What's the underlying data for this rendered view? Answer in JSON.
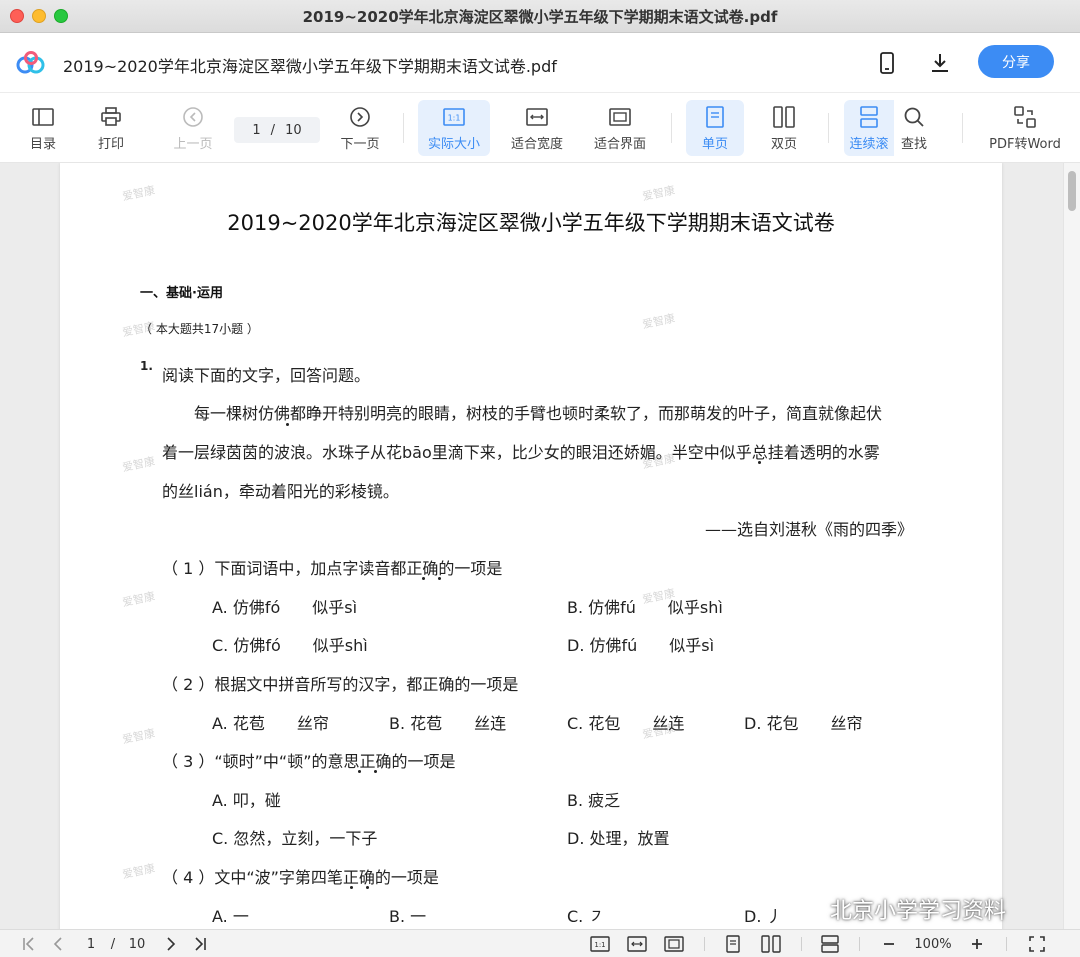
{
  "window": {
    "title": "2019~2020学年北京海淀区翠微小学五年级下学期期末语文试卷.pdf"
  },
  "header": {
    "doc_title": "2019~2020学年北京海淀区翠微小学五年级下学期期末语文试卷.pdf",
    "share_label": "分享",
    "icons": [
      "phone-icon",
      "download-icon"
    ]
  },
  "toolbar": {
    "toc": "目录",
    "print": "打印",
    "prev": "上一页",
    "page_current": "1",
    "page_sep": "/",
    "page_total": "10",
    "next": "下一页",
    "actual_size": "实际大小",
    "fit_width": "适合宽度",
    "fit_page": "适合界面",
    "single": "单页",
    "double": "双页",
    "continuous": "连续滚",
    "find": "查找",
    "to_word": "PDF转Word",
    "actual_size_icon_text": "1:1"
  },
  "document": {
    "title": "2019~2020学年北京海淀区翠微小学五年级下学期期末语文试卷",
    "section": "一、基础·运用",
    "section_note": "（ 本大题共17小题 ）",
    "q_number": "1.",
    "q_intro": "阅读下面的文字，回答问题。",
    "passage": [
      "每一棵树仿佛都睁开特别明亮的眼睛，树枝的手臂也顿时柔软了，而那萌发的叶子，简直就像起伏",
      "着一层绿茵茵的波浪。水珠子从花bāo里滴下来，比少女的眼泪还娇媚。半空中似乎总挂着透明的水雾",
      "的丝lián，牵动着阳光的彩棱镜。"
    ],
    "source": "——选自刘湛秋《雨的四季》",
    "sub1": "（ 1 ）下面词语中，加点字读音都正确的一项是",
    "sub1_options": [
      "A. 仿佛fó　　似乎sì",
      "B. 仿佛fú　　似乎shì",
      "C. 仿佛fó　　似乎shì",
      "D. 仿佛fú　　似乎sì"
    ],
    "sub2": "（ 2 ）根据文中拼音所写的汉字，都正确的一项是",
    "sub2_options": [
      "A. 花苞　　丝帘",
      "B. 花苞　　丝连",
      "C. 花包　　丝连",
      "D. 花包　　丝帘"
    ],
    "sub3": "（ 3 ）“顿时”中“顿”的意思正确的一项是",
    "sub3_options": [
      "A. 叩，碰",
      "B. 疲乏",
      "C. 忽然，立刻，一下子",
      "D. 处理，放置"
    ],
    "sub4": "（ 4 ）文中“波”字第四笔正确的一项是",
    "sub4_options": [
      "A. 一",
      "B. 一",
      "C. ㇇",
      "D. 丿"
    ],
    "watermark": "爱智康"
  },
  "statusbar": {
    "page_current": "1",
    "page_sep": "/",
    "page_total": "10",
    "zoom": "100%",
    "actual_icon_text": "1:1"
  },
  "overlay": {
    "wechat_text": "北京小学学习资料"
  },
  "colors": {
    "accent": "#3c8cf4",
    "active_bg": "#e6f0fd"
  }
}
